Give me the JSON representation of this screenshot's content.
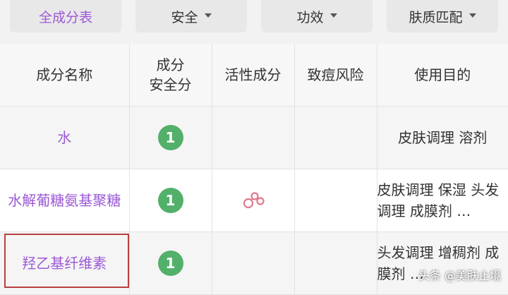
{
  "filters": [
    {
      "label": "全成分表",
      "active": true,
      "dropdown": false
    },
    {
      "label": "安全",
      "active": false,
      "dropdown": true
    },
    {
      "label": "功效",
      "active": false,
      "dropdown": true
    },
    {
      "label": "肤质匹配",
      "active": false,
      "dropdown": true
    }
  ],
  "table": {
    "headers": {
      "name": "成分名称",
      "safety_line1": "成分",
      "safety_line2": "安全分",
      "active": "活性成分",
      "acne": "致痘风险",
      "purpose": "使用目的"
    },
    "rows": [
      {
        "name": "水",
        "score": "1",
        "active": "",
        "acne": "",
        "purpose": "皮肤调理 溶剂"
      },
      {
        "name": "水解葡糖氨基聚糖",
        "score": "1",
        "active_icon": "active-ingredient-icon",
        "acne": "",
        "purpose": "皮肤调理 保湿 头发调理 成膜剂 …"
      },
      {
        "name": "羟乙基纤维素",
        "score": "1",
        "active": "",
        "acne": "",
        "purpose": "头发调理 增稠剂 成膜剂 …"
      }
    ]
  },
  "watermark": "头条 @美肤止境",
  "colors": {
    "accent": "#9b59d6",
    "score_badge": "#52b06a",
    "highlight": "#b94040"
  }
}
